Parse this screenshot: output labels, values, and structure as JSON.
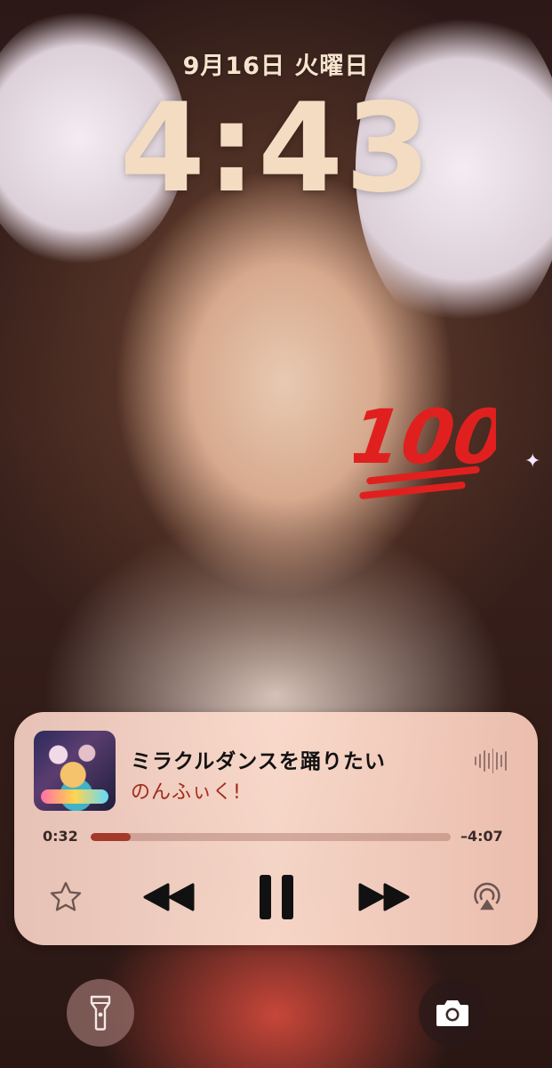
{
  "lockscreen": {
    "date": "9月16日 火曜日",
    "time": "4:43"
  },
  "now_playing": {
    "title": "ミラクルダンスを踊りたい",
    "artist": "のんふぃく!",
    "elapsed": "0:32",
    "remaining": "–4:07",
    "progress_fraction": 0.11
  },
  "controls": {
    "favorite_icon": "star-icon",
    "rewind_icon": "rewind-icon",
    "pause_icon": "pause-icon",
    "forward_icon": "fast-forward-icon",
    "airplay_icon": "airplay-icon",
    "audio_icon": "waveform-icon"
  },
  "quick_actions": {
    "left_icon": "flashlight-icon",
    "right_icon": "camera-icon"
  },
  "colors": {
    "clock": "#f4dcc2",
    "artist": "#a02c1d",
    "progress_fill": "#a43a2a"
  }
}
